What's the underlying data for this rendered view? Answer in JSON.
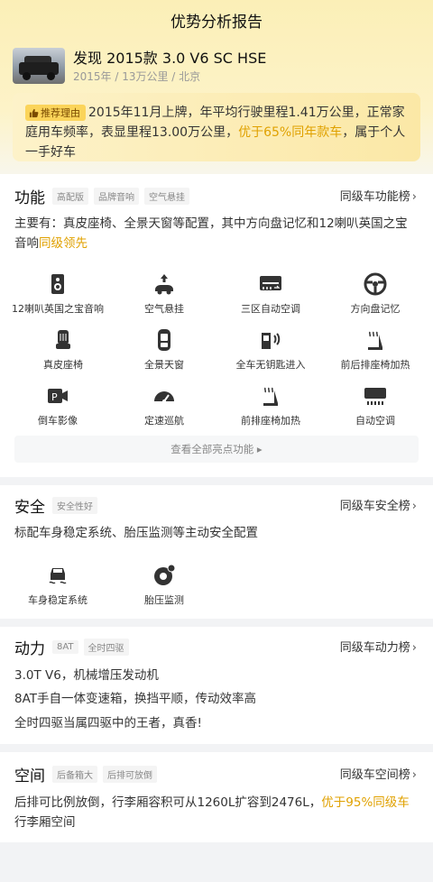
{
  "page": {
    "title": "优势分析报告"
  },
  "car": {
    "name": "发现 2015款 3.0 V6 SC HSE",
    "meta": "2015年 / 13万公里 / 北京"
  },
  "reason": {
    "tag": "推荐理由",
    "text_a": "2015年11月上牌，年平均行驶里程1.41万公里，正常家庭用车频率，表显里程13.00万公里，",
    "highlight": "优于65%同年款车",
    "text_b": "，属于个人一手好车"
  },
  "function": {
    "title": "功能",
    "chips": [
      "高配版",
      "品牌音响",
      "空气悬挂"
    ],
    "rank": "同级车功能榜",
    "desc_a": "主要有：真皮座椅、全景天窗等配置，其中方向盘记忆和12喇叭英国之宝音响",
    "desc_hl": "同级领先",
    "features": [
      {
        "label": "12喇叭英国之宝音响",
        "icon": "speaker-icon"
      },
      {
        "label": "空气悬挂",
        "icon": "air-suspension-icon"
      },
      {
        "label": "三区自动空调",
        "icon": "three-zone-ac-icon"
      },
      {
        "label": "方向盘记忆",
        "icon": "steering-wheel-icon"
      },
      {
        "label": "真皮座椅",
        "icon": "leather-seat-icon"
      },
      {
        "label": "全景天窗",
        "icon": "sunroof-icon"
      },
      {
        "label": "全车无钥匙进入",
        "icon": "keyless-entry-icon"
      },
      {
        "label": "前后排座椅加热",
        "icon": "seat-heating-icon"
      },
      {
        "label": "倒车影像",
        "icon": "reverse-camera-icon"
      },
      {
        "label": "定速巡航",
        "icon": "cruise-control-icon"
      },
      {
        "label": "前排座椅加热",
        "icon": "front-seat-heating-icon"
      },
      {
        "label": "自动空调",
        "icon": "auto-ac-icon"
      }
    ],
    "more": "查看全部亮点功能"
  },
  "safety": {
    "title": "安全",
    "chips": [
      "安全性好"
    ],
    "rank": "同级车安全榜",
    "desc": "标配车身稳定系统、胎压监测等主动安全配置",
    "features": [
      {
        "label": "车身稳定系统",
        "icon": "stability-control-icon"
      },
      {
        "label": "胎压监测",
        "icon": "tire-pressure-icon"
      }
    ]
  },
  "power": {
    "title": "动力",
    "chips": [
      "8AT",
      "全时四驱"
    ],
    "rank": "同级车动力榜",
    "lines": [
      "3.0T V6，机械增压发动机",
      "8AT手自一体变速箱，换挡平顺，传动效率高",
      "全时四驱当属四驱中的王者，真香!"
    ]
  },
  "space": {
    "title": "空间",
    "chips": [
      "后备箱大",
      "后排可放倒"
    ],
    "rank": "同级车空间榜",
    "desc_a": "后排可比例放倒，行李厢容积可从1260L扩容到2476L，",
    "desc_hl": "优于95%同级车",
    "desc_b": "行李厢空间"
  },
  "colors": {
    "accent": "#e0a100",
    "tag_bg": "#fbd45a",
    "icon": "#333333"
  }
}
